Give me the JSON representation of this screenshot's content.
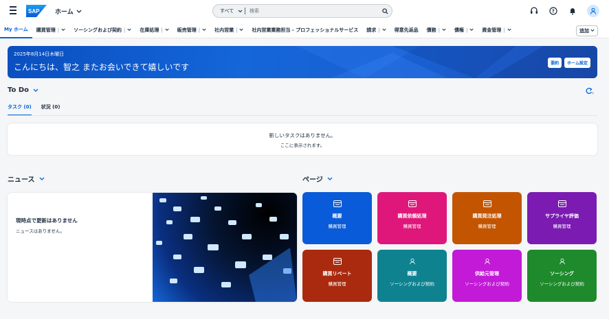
{
  "shell": {
    "home_label": "ホーム",
    "search_scope": "すべて",
    "search_placeholder": "検索"
  },
  "menu": {
    "items": [
      {
        "label": "My ホーム",
        "active": true,
        "dropdown": false
      },
      {
        "label": "購買管理",
        "dropdown": true
      },
      {
        "label": "ソーシングおよび契約",
        "dropdown": true
      },
      {
        "label": "在庫処理",
        "dropdown": true
      },
      {
        "label": "販売管理",
        "dropdown": true
      },
      {
        "label": "社内営業",
        "dropdown": true
      },
      {
        "label": "社内営業業務担当 - プロフェッショナルサービス",
        "dropdown": false
      },
      {
        "label": "請求",
        "dropdown": true
      },
      {
        "label": "得意先返品",
        "dropdown": false
      },
      {
        "label": "債務",
        "dropdown": true
      },
      {
        "label": "債権",
        "dropdown": true
      },
      {
        "label": "資金管理",
        "dropdown": true
      }
    ],
    "add_label": "追加"
  },
  "banner": {
    "date": "2025年8月14日木曜日",
    "greeting": "こんにちは、智之 またお会いできて嬉しいです",
    "summary_button": "要約",
    "settings_button": "ホーム設定"
  },
  "todo": {
    "title": "To Do",
    "tabs": [
      {
        "label": "タスク (0)",
        "active": true
      },
      {
        "label": "状況 (0)",
        "active": false
      }
    ],
    "empty_line1": "新しいタスクはありません。",
    "empty_line2": "ここに表示されます。"
  },
  "news": {
    "title": "ニュース",
    "heading": "現時点で更新はありません",
    "subtext": "ニュースはありません。"
  },
  "pages": {
    "title": "ページ",
    "tiles": [
      {
        "title": "概要",
        "subtitle": "購買管理",
        "color": "#0a5bd9",
        "icon": "app-icon"
      },
      {
        "title": "購買依頼処理",
        "subtitle": "購買管理",
        "color": "#e0177a",
        "icon": "app-icon"
      },
      {
        "title": "購買発注処理",
        "subtitle": "購買管理",
        "color": "#c35500",
        "icon": "app-icon"
      },
      {
        "title": "サプライヤ評価",
        "subtitle": "購買管理",
        "color": "#7b1bb1",
        "icon": "app-icon"
      },
      {
        "title": "購買リベート",
        "subtitle": "購買管理",
        "color": "#aa2a0f",
        "icon": "app-icon"
      },
      {
        "title": "概要",
        "subtitle": "ソーシングおよび契約",
        "color": "#0f8290",
        "icon": "person-icon"
      },
      {
        "title": "供給元管理",
        "subtitle": "ソーシングおよび契約",
        "color": "#c21ad6",
        "icon": "person-icon"
      },
      {
        "title": "ソーシング",
        "subtitle": "ソーシングおよび契約",
        "color": "#1e8a2c",
        "icon": "person-icon"
      }
    ]
  },
  "colors": {
    "accent": "#0064d9",
    "banner": "#0a4fc0"
  }
}
